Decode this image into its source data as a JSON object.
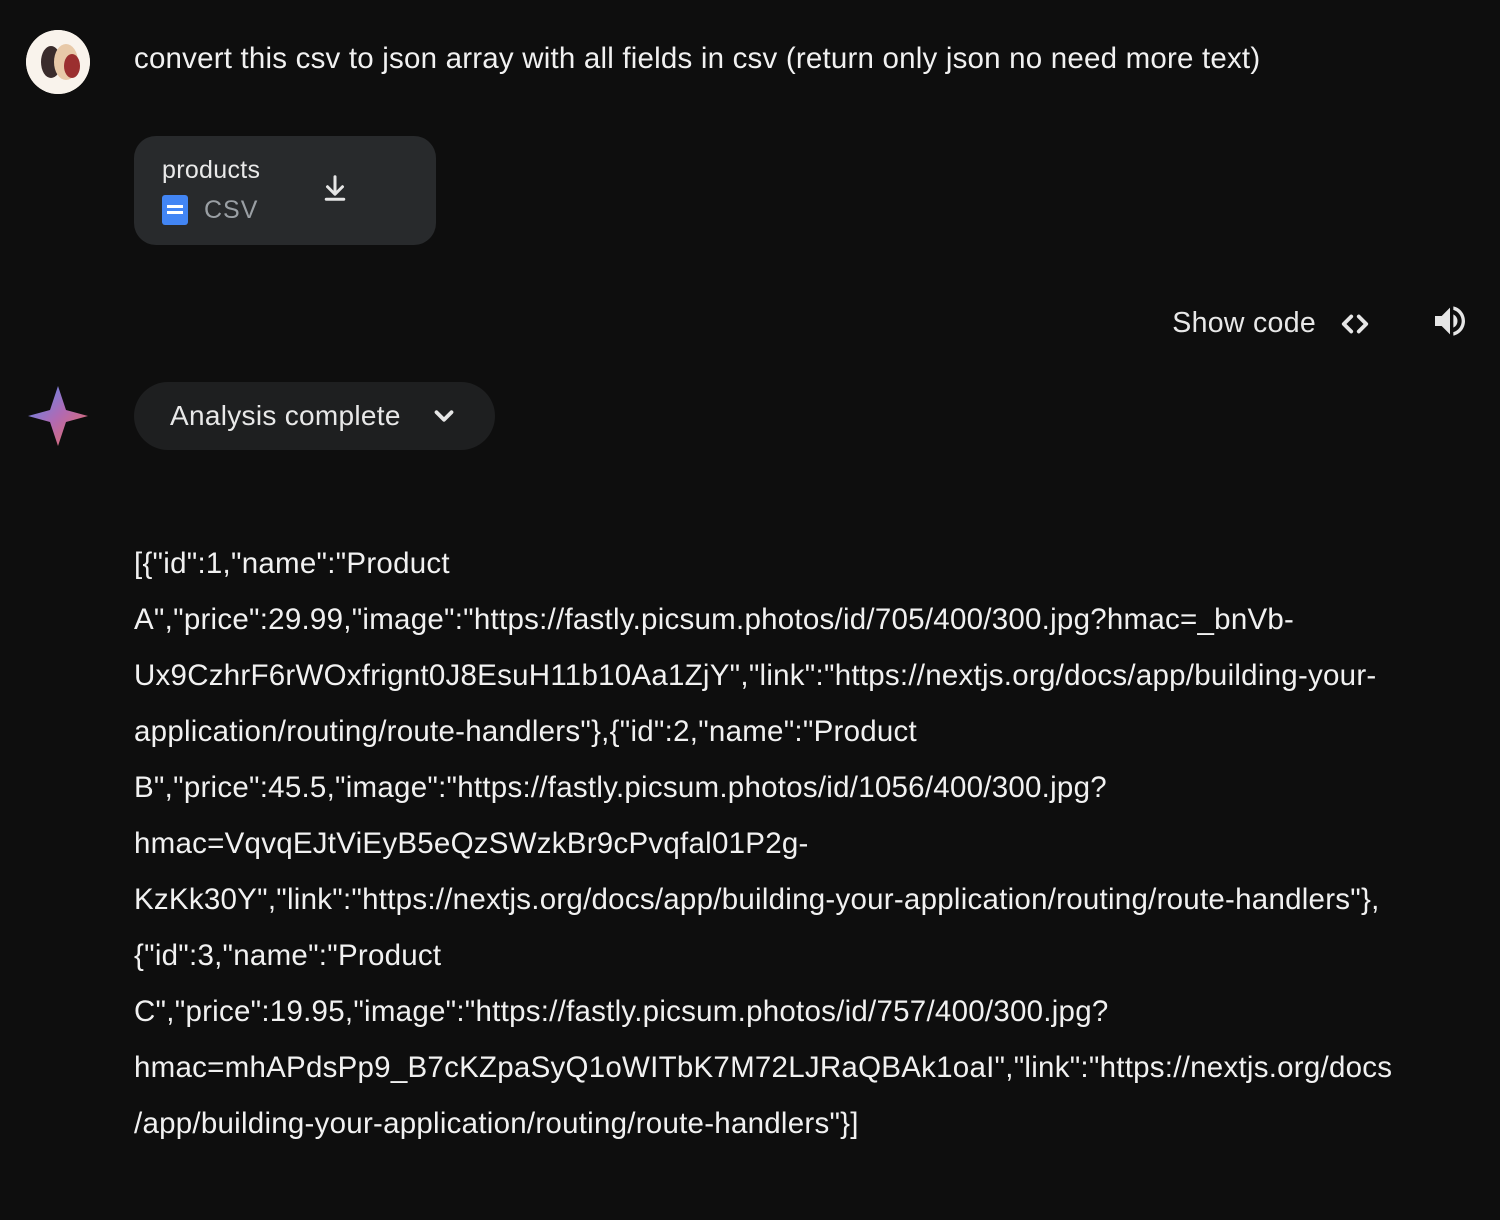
{
  "user": {
    "prompt": " convert this csv to json array with all fields in csv (return only json no need more text)"
  },
  "attachment": {
    "name": "products",
    "type": "CSV"
  },
  "actions": {
    "showCode": "Show code"
  },
  "chip": {
    "label": "Analysis complete"
  },
  "response": {
    "body": "[{\"id\":1,\"name\":\"Product A\",\"price\":29.99,\"image\":\"https://fastly.picsum.photos/id/705/400/300.jpg?hmac=_bnVb-Ux9CzhrF6rWOxfrignt0J8EsuH11b10Aa1ZjY\",\"link\":\"https://nextjs.org/docs/app/building-your-application/routing/route-handlers\"},{\"id\":2,\"name\":\"Product B\",\"price\":45.5,\"image\":\"https://fastly.picsum.photos/id/1056/400/300.jpg?hmac=VqvqEJtViEyB5eQzSWzkBr9cPvqfal01P2g-KzKk30Y\",\"link\":\"https://nextjs.org/docs/app/building-your-application/routing/route-handlers\"},{\"id\":3,\"name\":\"Product C\",\"price\":19.95,\"image\":\"https://fastly.picsum.photos/id/757/400/300.jpg?hmac=mhAPdsPp9_B7cKZpaSyQ1oWITbK7M72LJRaQBAk1oaI\",\"link\":\"https://nextjs.org/docs/app/building-your-application/routing/route-handlers\"}]"
  }
}
